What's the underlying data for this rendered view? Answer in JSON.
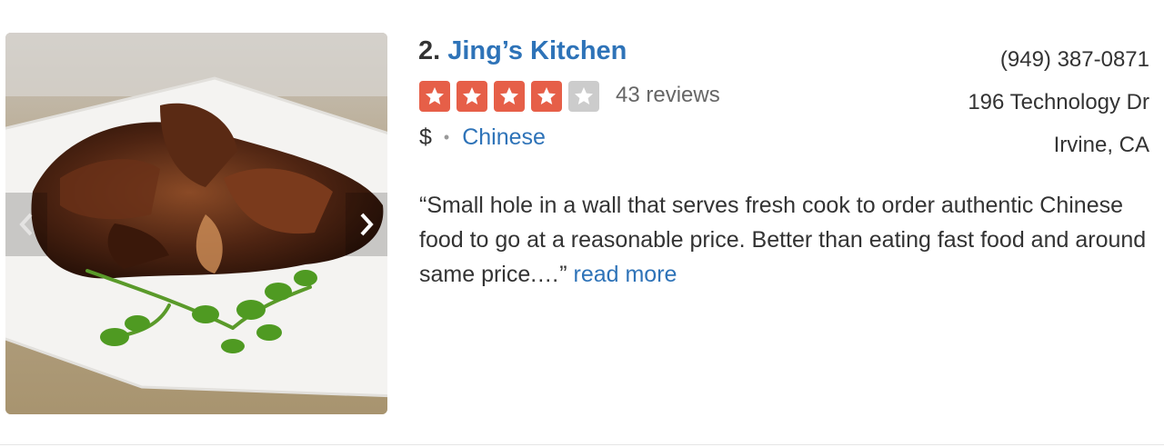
{
  "business": {
    "number": "2.",
    "name": "Jing’s Kitchen",
    "rating": 4,
    "rating_max": 5,
    "review_count": "43 reviews",
    "price": "$",
    "category": "Chinese",
    "star_color": "#e65f48",
    "star_empty_color": "#cccccc"
  },
  "contact": {
    "phone": "(949) 387-0871",
    "street": "196 Technology Dr",
    "city": "Irvine, CA"
  },
  "snippet": {
    "text": "“Small hole in a wall that serves fresh cook to order authentic Chinese food to go at a reasonable price. Better than eating fast food and around same price.…”",
    "read_more": "read more"
  },
  "photo": {
    "prev_icon": "chevron-left-icon",
    "next_icon": "chevron-right-icon"
  },
  "colors": {
    "link": "#2e73b8",
    "text": "#333333"
  }
}
